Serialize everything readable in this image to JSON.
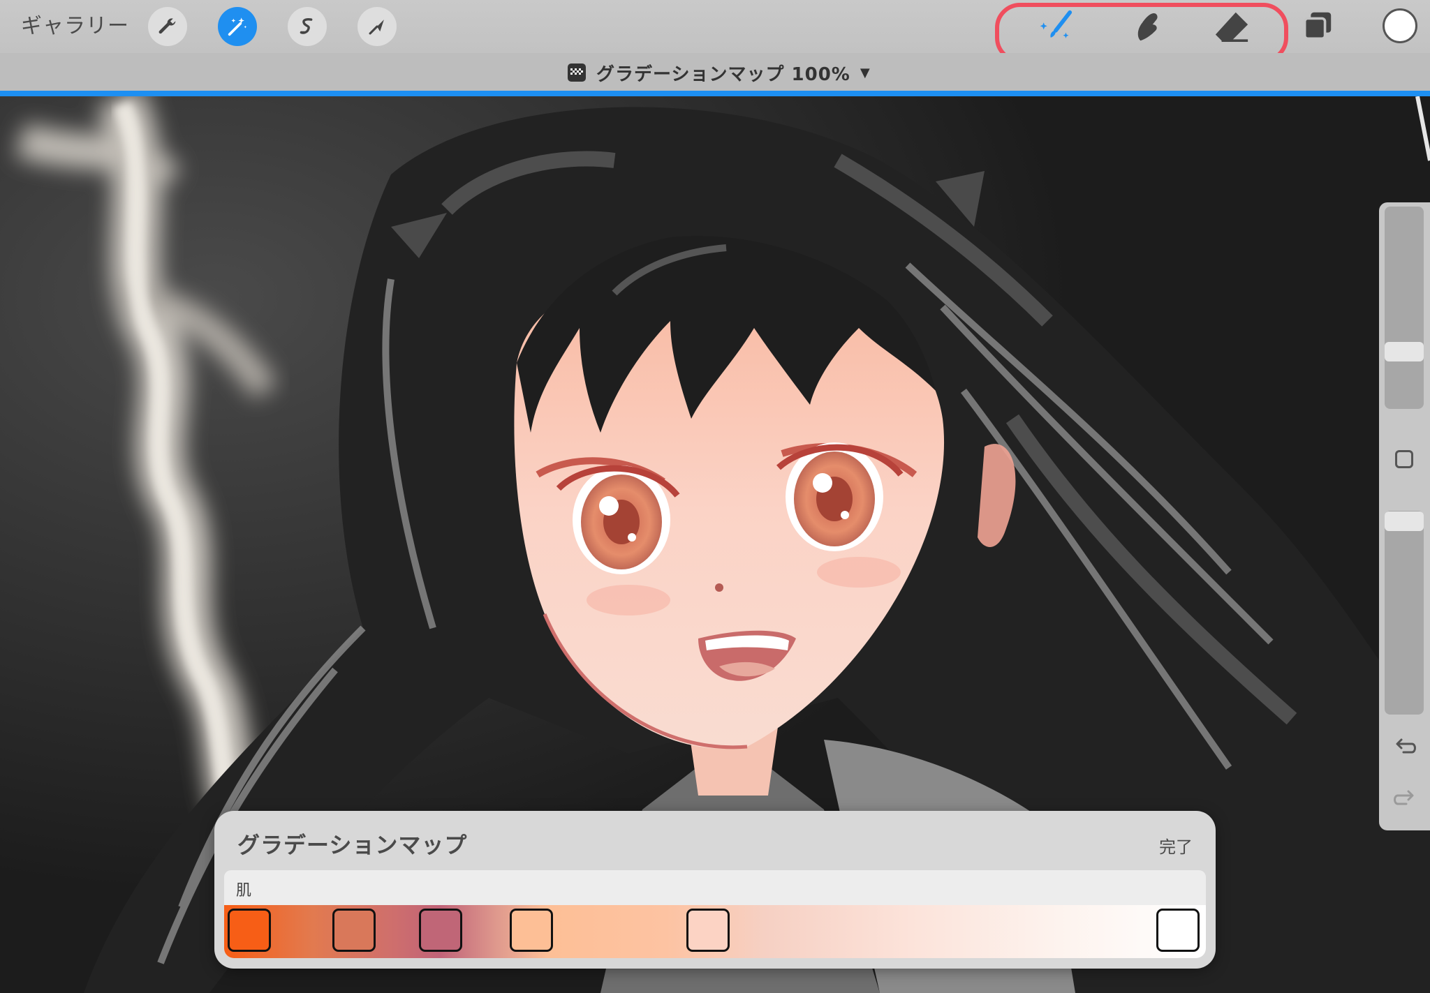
{
  "toolbar": {
    "gallery_label": "ギャラリー",
    "actions_icon": "wrench-icon",
    "adjustments_icon": "magic-wand-icon",
    "selection_icon": "selection-s-icon",
    "transform_icon": "arrow-cursor-icon",
    "brush_icon": "brush-icon",
    "smudge_icon": "smudge-finger-icon",
    "eraser_icon": "eraser-icon",
    "layers_icon": "layers-icon",
    "current_color": "#ffffff",
    "accent_color": "#1f8ff0",
    "highlight_color": "#f04e5e"
  },
  "adjustment": {
    "title": "グラデーションマップ 100%",
    "caret": "▼"
  },
  "panel": {
    "title": "グラデーションマップ",
    "done_label": "完了",
    "preset_name": "肌",
    "stops": [
      {
        "color": "#f75e16"
      },
      {
        "color": "#d9785a"
      },
      {
        "color": "#c06677"
      },
      {
        "color": "#fdbf96"
      },
      {
        "color": "#fcd3c4"
      },
      {
        "color": "#ffffff"
      }
    ]
  }
}
